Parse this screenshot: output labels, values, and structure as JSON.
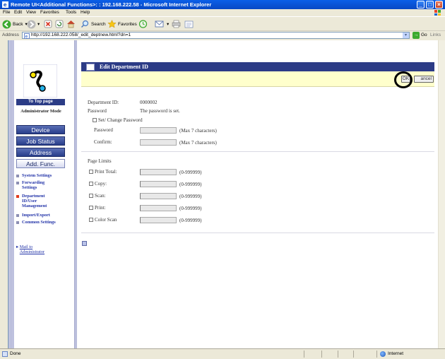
{
  "window": {
    "title": "Remote UI<Additional Functions>: : 192.168.222.58 - Microsoft Internet Explorer"
  },
  "menu": [
    "File",
    "Edit",
    "View",
    "Favorites",
    "Tools",
    "Help"
  ],
  "toolbar": {
    "back": "Back",
    "search": "Search",
    "favorites": "Favorites"
  },
  "address": {
    "label": "Address",
    "url": "http://192.168.222.058/_edit_deptnew.html?dn=1",
    "go": "Go",
    "links": "Links"
  },
  "sidebar": {
    "top_page": "To Top page",
    "mode": "Administrator Mode",
    "buttons": [
      "Device",
      "Job Status",
      "Address",
      "Add. Func."
    ],
    "active_button": "Add. Func.",
    "links": [
      {
        "label": "System Settings"
      },
      {
        "label": "Forwarding Settings"
      },
      {
        "label": "Department ID/User Management",
        "active": true
      },
      {
        "label": "Import/Export"
      },
      {
        "label": "Common Settings"
      }
    ],
    "mail": "Mail to Administrator"
  },
  "panel": {
    "title": "Edit Department ID",
    "ok": "OK",
    "cancel": "ancel",
    "department_id_label": "Department ID:",
    "department_id_value": "0000002",
    "password_label": "Password",
    "password_value": "The password is set.",
    "set_change_password": "Set/ Change Password",
    "password_field_label": "Password",
    "password_hint": "(Max 7 characters)",
    "confirm_label": "Confirm:",
    "confirm_hint": "(Max 7 characters)",
    "page_limits": "Page Limits",
    "limits": [
      {
        "label": "Print Total:",
        "range": "(0-999999)"
      },
      {
        "label": "Copy:",
        "range": "(0-999999)"
      },
      {
        "label": "Scan:",
        "range": "(0-999999)"
      },
      {
        "label": "Print:",
        "range": "(0-999999)"
      },
      {
        "label": "Color Scan",
        "range": "(0-999999)"
      }
    ]
  },
  "status": {
    "left": "Done",
    "zone": "Internet"
  },
  "colors": {
    "titlebar": "#0A5FE8",
    "panel_header": "#2C3B86",
    "action_bar": "#FFFFCC",
    "nav_button": "#283D8A",
    "link": "#2233A8"
  }
}
